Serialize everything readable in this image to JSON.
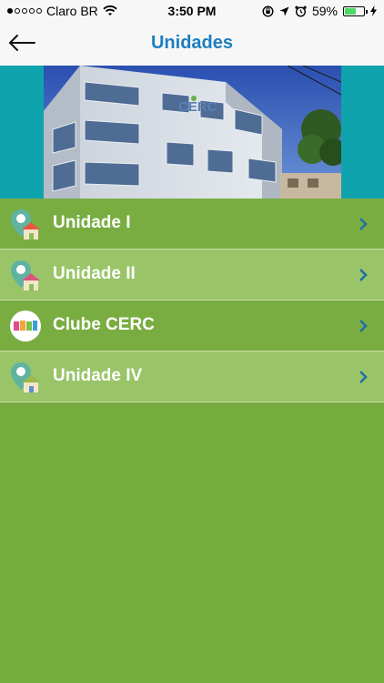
{
  "status_bar": {
    "carrier": "Claro BR",
    "time": "3:50 PM",
    "battery_percent": "59%",
    "battery_level": 0.59,
    "signal_filled": 1,
    "signal_total": 5
  },
  "nav": {
    "title": "Unidades",
    "back_icon": "arrow-left-icon"
  },
  "banner": {
    "sign_text": "CERC"
  },
  "units": [
    {
      "label": "Unidade I",
      "icon": "map-pin-house-icon"
    },
    {
      "label": "Unidade II",
      "icon": "map-pin-house-icon"
    },
    {
      "label": "Clube CERC",
      "icon": "clube-logo-icon"
    },
    {
      "label": "Unidade IV",
      "icon": "map-pin-house-icon"
    }
  ],
  "colors": {
    "title_blue": "#1c7fc0",
    "list_dark": "#79ad42",
    "list_light": "#99c468",
    "background": "#76ab3e",
    "banner_teal": "#0fa3ad",
    "chevron": "#1f6fa6"
  }
}
